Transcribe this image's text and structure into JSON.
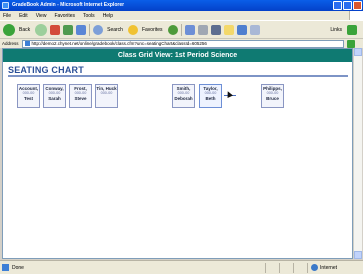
{
  "window": {
    "title": "GradeBook Admin - Microsoft Internet Explorer"
  },
  "menu": [
    "File",
    "Edit",
    "View",
    "Favorites",
    "Tools",
    "Help"
  ],
  "toolbar": {
    "back_label": "Back",
    "search_label": "Search",
    "favorites_label": "Favorites",
    "links_label": "Links"
  },
  "address": {
    "label": "Address",
    "url": "http://demo2.chynet.net/online/gradebook/class.cfm?unc=seatingChart&classId=605256"
  },
  "page": {
    "banner": "Class Grid View: 1st Period Science",
    "heading": "Seating Chart"
  },
  "desks": [
    {
      "name": "Account,",
      "sub": "000-00",
      "first": "Test"
    },
    {
      "name": "Conway,",
      "sub": "000-00",
      "first": "Sarah"
    },
    {
      "name": "Frost,",
      "sub": "000-00",
      "first": "Steve"
    },
    {
      "name": "Tin, Huck",
      "sub": "000-00",
      "first": ""
    },
    {
      "name": "Smith,",
      "sub": "000-00",
      "first": "Deborah"
    },
    {
      "name": "Taylor,",
      "sub": "000-00",
      "first": "Beth"
    },
    {
      "name": "Philipps,",
      "sub": "000-00",
      "first": "Bruce"
    }
  ],
  "status": {
    "text": "Done",
    "zone": "Internet"
  },
  "colors": {
    "banner": "#0f7a72",
    "heading": "#2a4f97",
    "titlebar": "#0a5ee8"
  }
}
